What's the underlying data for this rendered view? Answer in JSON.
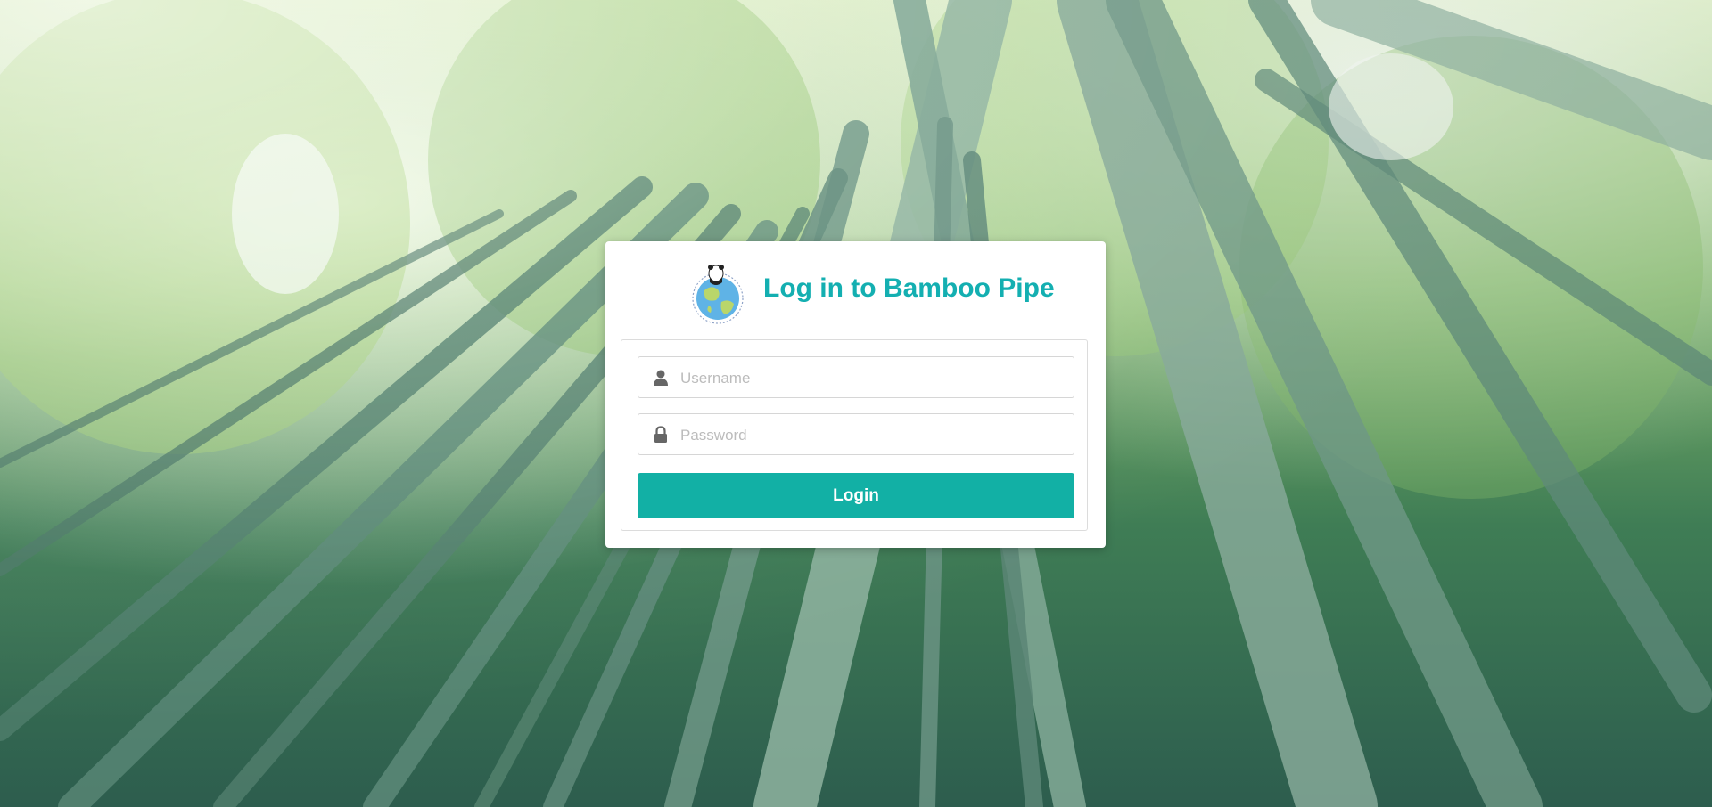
{
  "page": {
    "title": "Log in to Bamboo Pipe",
    "logo_icon": "globe-panda-logo"
  },
  "form": {
    "username": {
      "placeholder": "Username",
      "value": "",
      "icon": "user-icon"
    },
    "password": {
      "placeholder": "Password",
      "value": "",
      "icon": "lock-icon"
    },
    "submit_label": "Login"
  },
  "colors": {
    "accent": "#14afb1",
    "button": "#12b0a5",
    "card": "#ffffff"
  }
}
